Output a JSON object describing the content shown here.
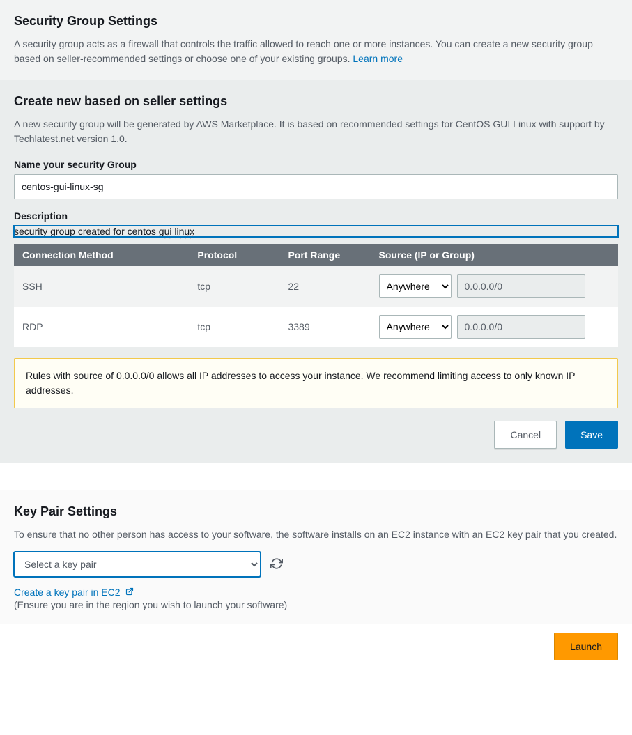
{
  "security_group": {
    "title": "Security Group Settings",
    "description_pre": "A security group acts as a firewall that controls the traffic allowed to reach one or more instances. You can create a new security group based on seller-recommended settings or choose one of your existing groups. ",
    "learn_more": "Learn more"
  },
  "create_new": {
    "title": "Create new based on seller settings",
    "description": "A new security group will be generated by AWS Marketplace. It is based on recommended settings for CentOS GUI Linux with support by Techlatest.net version 1.0.",
    "name_label": "Name your security Group",
    "name_value": "centos-gui-linux-sg",
    "desc_label": "Description",
    "desc_value_prefix": "security group created for centos ",
    "desc_value_mis1": "gui",
    "desc_value_mid": " ",
    "desc_value_mis2": "linux",
    "desc_full": "security group created for centos gui linux",
    "table": {
      "headers": {
        "method": "Connection Method",
        "protocol": "Protocol",
        "port": "Port Range",
        "source": "Source (IP or Group)"
      },
      "rows": [
        {
          "method": "SSH",
          "protocol": "tcp",
          "port": "22",
          "source_opt": "Anywhere",
          "source_ip": "0.0.0.0/0"
        },
        {
          "method": "RDP",
          "protocol": "tcp",
          "port": "3389",
          "source_opt": "Anywhere",
          "source_ip": "0.0.0.0/0"
        }
      ]
    },
    "warning": "Rules with source of 0.0.0.0/0 allows all IP addresses to access your instance. We recommend limiting access to only known IP addresses.",
    "cancel": "Cancel",
    "save": "Save"
  },
  "key_pair": {
    "title": "Key Pair Settings",
    "description": "To ensure that no other person has access to your software, the software installs on an EC2 instance with an EC2 key pair that you created.",
    "placeholder": "Select a key pair",
    "create_link": "Create a key pair in EC2",
    "hint": "(Ensure you are in the region you wish to launch your software)"
  },
  "footer": {
    "launch": "Launch"
  }
}
